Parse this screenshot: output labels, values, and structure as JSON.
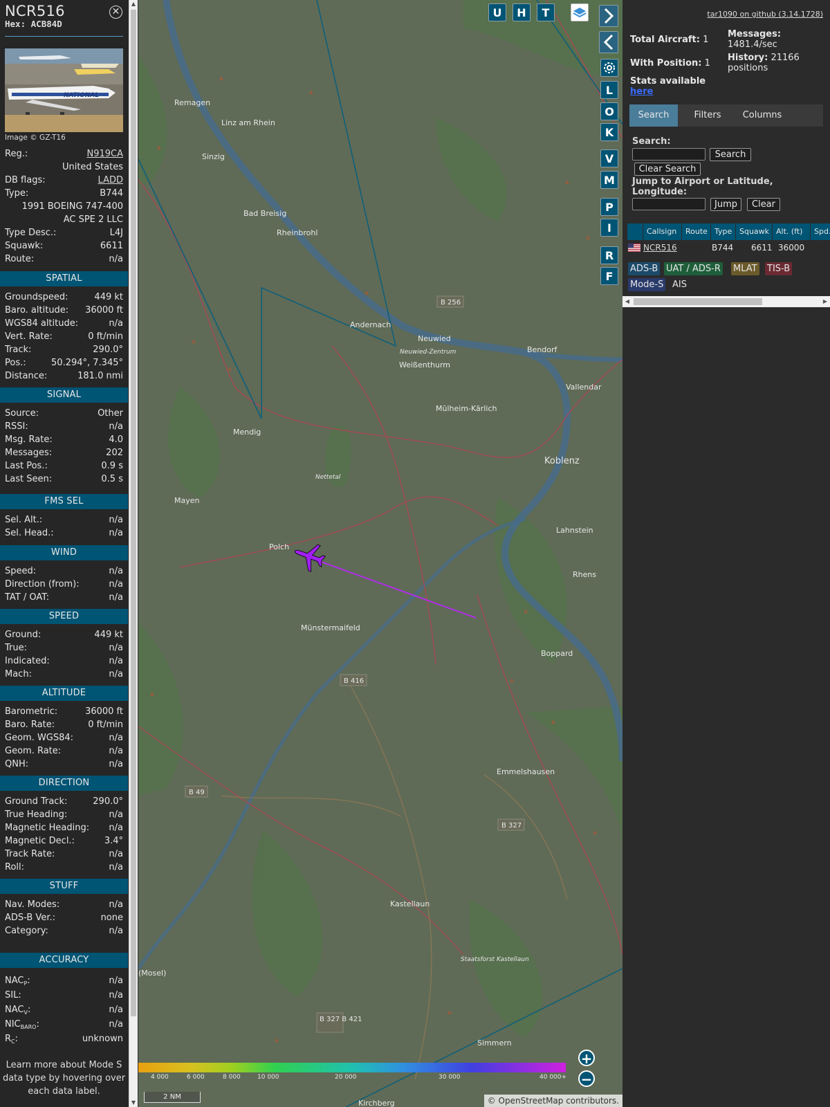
{
  "aircraft": {
    "callsign": "NCR516",
    "hex_label": "Hex:",
    "hex": "ACB84D",
    "photo_credit": "Image © GZ-T16"
  },
  "info_rows": [
    {
      "k": "Reg.:",
      "v": "N919CA"
    },
    {
      "k": "",
      "v": "United States"
    },
    {
      "k": "DB flags:",
      "v": "LADD"
    },
    {
      "k": "Type:",
      "v": "B744"
    },
    {
      "k": "",
      "v": "1991 BOEING 747-400"
    },
    {
      "k": "",
      "v": "AC SPE 2 LLC"
    },
    {
      "k": "Type Desc.:",
      "v": "L4J"
    },
    {
      "k": "Squawk:",
      "v": "6611"
    },
    {
      "k": "Route:",
      "v": "n/a"
    }
  ],
  "sections": {
    "spatial": {
      "title": "SPATIAL",
      "rows": [
        {
          "k": "Groundspeed:",
          "v": "449 kt"
        },
        {
          "k": "Baro. altitude:",
          "v": "36000 ft"
        },
        {
          "k": "WGS84 altitude:",
          "v": "n/a"
        },
        {
          "k": "Vert. Rate:",
          "v": "0 ft/min"
        },
        {
          "k": "Track:",
          "v": "290.0°"
        },
        {
          "k": "Pos.:",
          "v": "50.294°, 7.345°"
        },
        {
          "k": "Distance:",
          "v": "181.0 nmi"
        }
      ]
    },
    "signal": {
      "title": "SIGNAL",
      "rows": [
        {
          "k": "Source:",
          "v": "Other"
        },
        {
          "k": "RSSI:",
          "v": "n/a"
        },
        {
          "k": "Msg. Rate:",
          "v": "4.0"
        },
        {
          "k": "Messages:",
          "v": "202"
        },
        {
          "k": "Last Pos.:",
          "v": "0.9 s"
        },
        {
          "k": "Last Seen:",
          "v": "0.5 s"
        }
      ]
    },
    "fms": {
      "title": "FMS SEL",
      "rows": [
        {
          "k": "Sel. Alt.:",
          "v": "n/a"
        },
        {
          "k": "Sel. Head.:",
          "v": "n/a"
        }
      ]
    },
    "wind": {
      "title": "WIND",
      "rows": [
        {
          "k": "Speed:",
          "v": "n/a"
        },
        {
          "k": "Direction (from):",
          "v": "n/a"
        },
        {
          "k": "TAT / OAT:",
          "v": "n/a"
        }
      ]
    },
    "speed": {
      "title": "SPEED",
      "rows": [
        {
          "k": "Ground:",
          "v": "449 kt"
        },
        {
          "k": "True:",
          "v": "n/a"
        },
        {
          "k": "Indicated:",
          "v": "n/a"
        },
        {
          "k": "Mach:",
          "v": "n/a"
        }
      ]
    },
    "altitude": {
      "title": "ALTITUDE",
      "rows": [
        {
          "k": "Barometric:",
          "v": "36000 ft"
        },
        {
          "k": "Baro. Rate:",
          "v": "0 ft/min"
        },
        {
          "k": "Geom. WGS84:",
          "v": "n/a"
        },
        {
          "k": "Geom. Rate:",
          "v": "n/a"
        },
        {
          "k": "QNH:",
          "v": "n/a"
        }
      ]
    },
    "direction": {
      "title": "DIRECTION",
      "rows": [
        {
          "k": "Ground Track:",
          "v": "290.0°"
        },
        {
          "k": "True Heading:",
          "v": "n/a"
        },
        {
          "k": "Magnetic Heading:",
          "v": "n/a"
        },
        {
          "k": "Magnetic Decl.:",
          "v": "3.4°"
        },
        {
          "k": "Track Rate:",
          "v": "n/a"
        },
        {
          "k": "Roll:",
          "v": "n/a"
        }
      ]
    },
    "stuff": {
      "title": "STUFF",
      "rows": [
        {
          "k": "Nav. Modes:",
          "v": "n/a"
        },
        {
          "k": "ADS-B Ver.:",
          "v": "none"
        },
        {
          "k": "Category:",
          "v": "n/a"
        }
      ]
    },
    "accuracy": {
      "title": "ACCURACY",
      "rows": [
        {
          "k": "NAC",
          "sub": "P",
          "v": "n/a"
        },
        {
          "k": "SIL:",
          "v": "n/a"
        },
        {
          "k": "NAC",
          "sub": "V",
          "v": "n/a"
        },
        {
          "k": "NIC",
          "sub": "BARO",
          "v": "n/a"
        },
        {
          "k": "R",
          "sub": "C",
          "v": "unknown"
        }
      ]
    }
  },
  "learn_more": "Learn more about Mode S data type by hovering over each data label.",
  "map": {
    "top_buttons": [
      "U",
      "H",
      "T"
    ],
    "side_buttons": [
      "L",
      "O",
      "K",
      "V",
      "M",
      "P",
      "I",
      "R",
      "F"
    ],
    "places": [
      "Remagen",
      "Linz am Rhein",
      "Sinzig",
      "Bad Breisig",
      "Rheinbrohl",
      "Andernach",
      "Neuwied",
      "Neuwied-Zentrum",
      "Weißenthurm",
      "Bendorf",
      "Vallendar",
      "Mülheim-Kärlich",
      "Koblenz",
      "Lahnstein",
      "Mendig",
      "Mayen",
      "Polch",
      "Münstermaifeld",
      "Rhens",
      "Boppard",
      "Emmelshausen",
      "Kastellaun",
      "Staatsforst Kastellaun",
      "Simmern",
      "Kirchberg",
      "(Mosel)",
      "Nettetal",
      "B 256",
      "B 416",
      "B 49",
      "B 327",
      "B 327 B 421"
    ],
    "altitude_scale": [
      "4 000",
      "6 000",
      "8 000",
      "10 000",
      "20 000",
      "30 000",
      "40 000+"
    ],
    "scale_label": "2 NM",
    "attribution": "© OpenStreetMap contributors.",
    "plane_color": "#a020f0"
  },
  "sidebar": {
    "github_link": "tar1090 on github (3.14.1728)",
    "total_aircraft_label": "Total Aircraft:",
    "total_aircraft": "1",
    "with_position_label": "With Position:",
    "with_position": "1",
    "messages_label": "Messages:",
    "messages_rate": "1481.4/sec",
    "history_label": "History:",
    "history_value": "21166",
    "history_unit": "positions",
    "stats_label": "Stats available",
    "stats_link": "here",
    "tabs": [
      "Search",
      "Filters",
      "Columns"
    ],
    "search_label": "Search:",
    "search_button": "Search",
    "clear_search_button": "Clear Search",
    "jump_label": "Jump to Airport or Latitude, Longitude:",
    "jump_button": "Jump",
    "clear_button": "Clear",
    "columns": [
      "Callsign",
      "Route",
      "Type",
      "Squawk",
      "Alt. (ft)",
      "Spd."
    ],
    "row": {
      "callsign": "NCR516",
      "route": "",
      "type": "B744",
      "squawk": "6611",
      "alt": "36000"
    },
    "sources": [
      {
        "label": "ADS-B",
        "color": "#1c4a6b"
      },
      {
        "label": "UAT / ADS-R",
        "color": "#1f5e3a"
      },
      {
        "label": "MLAT",
        "color": "#6b5a2a"
      },
      {
        "label": "TIS-B",
        "color": "#6b2a33"
      },
      {
        "label": "Mode-S",
        "color": "#2a3a6b"
      },
      {
        "label": "AIS",
        "color": ""
      }
    ]
  }
}
